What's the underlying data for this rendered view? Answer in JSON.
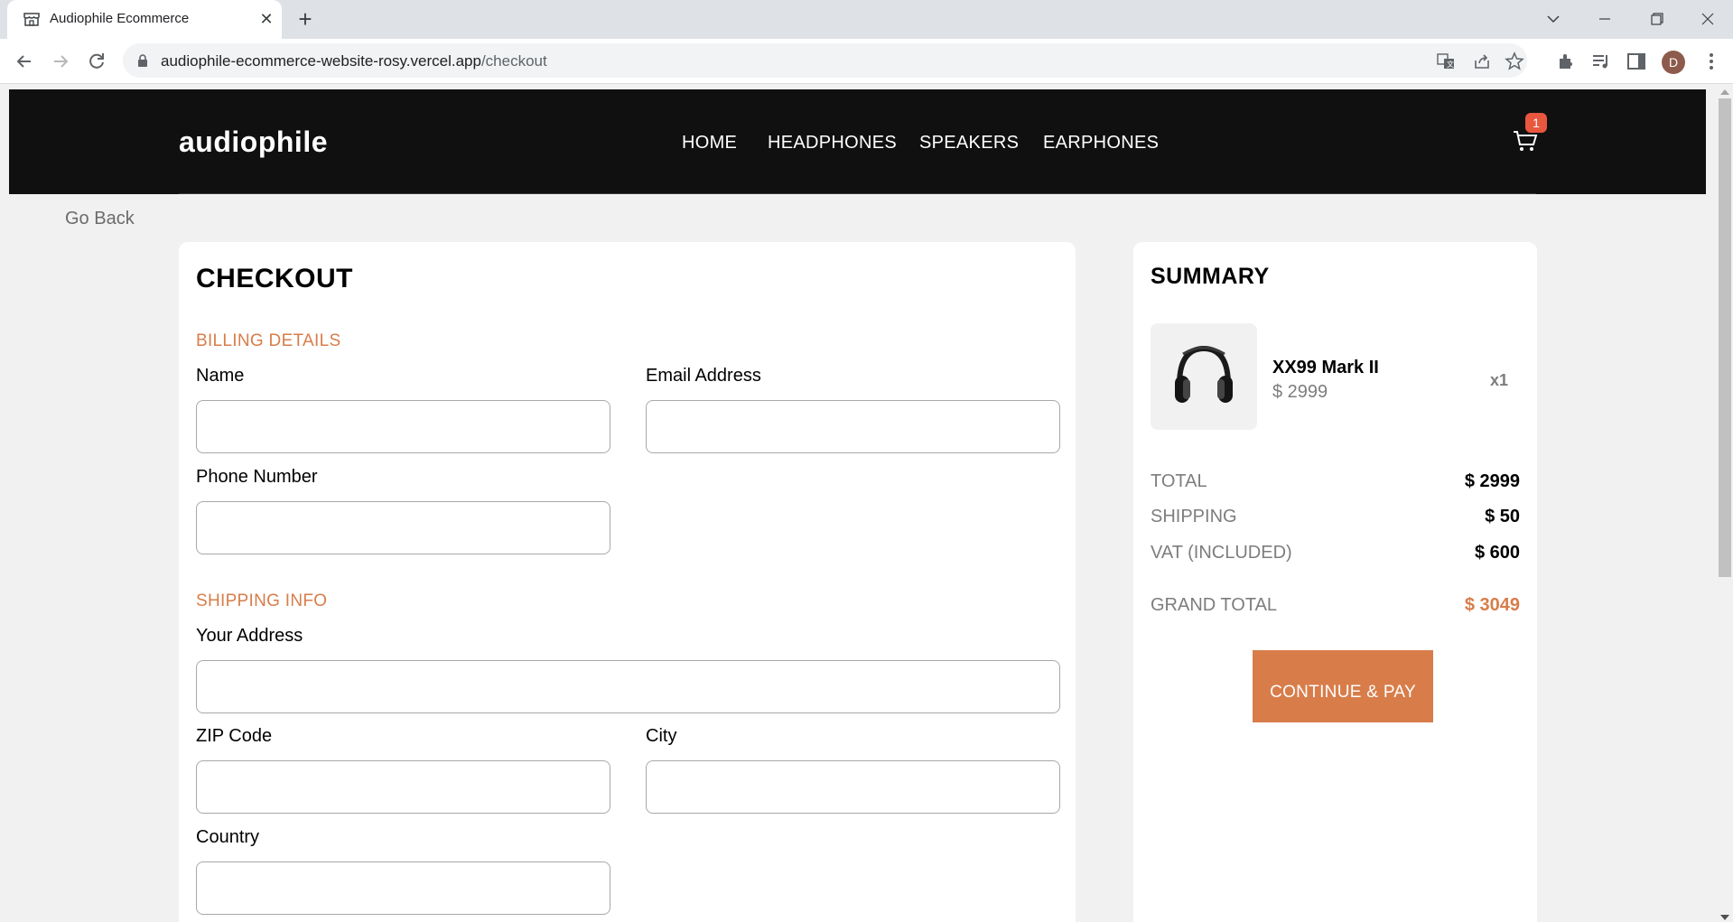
{
  "browser": {
    "tab_title": "Audiophile Ecommerce",
    "tab_close": "✕",
    "new_tab": "+",
    "url_host": "audiophile-ecommerce-website-rosy.vercel.app",
    "url_path": "/checkout",
    "profile_initial": "D",
    "icons": [
      "back-arrow-icon",
      "forward-arrow-icon",
      "reload-icon",
      "lock-icon",
      "translate-icon",
      "share-icon",
      "star-icon",
      "extensions-icon",
      "media-icon",
      "side-panel-icon",
      "menu-dots-icon"
    ]
  },
  "header": {
    "logo": "audiophile",
    "nav": [
      "HOME",
      "HEADPHONES",
      "SPEAKERS",
      "EARPHONES"
    ],
    "cart_count": "1"
  },
  "go_back": "Go Back",
  "checkout": {
    "title": "CHECKOUT",
    "billing_title": "BILLING DETAILS",
    "name_label": "Name",
    "email_label": "Email Address",
    "phone_label": "Phone Number",
    "shipping_title": "SHIPPING INFO",
    "address_label": "Your Address",
    "zip_label": "ZIP Code",
    "city_label": "City",
    "country_label": "Country",
    "values": {
      "name": "",
      "email": "",
      "phone": "",
      "address": "",
      "zip": "",
      "city": "",
      "country": ""
    }
  },
  "summary": {
    "title": "SUMMARY",
    "item": {
      "name": "XX99 Mark II",
      "price": "$ 2999",
      "qty": "x1"
    },
    "rows": [
      {
        "label": "TOTAL",
        "value": "$ 2999"
      },
      {
        "label": "SHIPPING",
        "value": "$ 50"
      },
      {
        "label": "VAT (INCLUDED)",
        "value": "$ 600"
      }
    ],
    "grand_total_label": "GRAND TOTAL",
    "grand_total_value": "$ 3049",
    "pay_button": "CONTINUE & PAY"
  },
  "colors": {
    "accent": "#d87d4a",
    "header_bg": "#101010",
    "page_bg": "#f1f1f1",
    "badge": "#e9573f"
  }
}
